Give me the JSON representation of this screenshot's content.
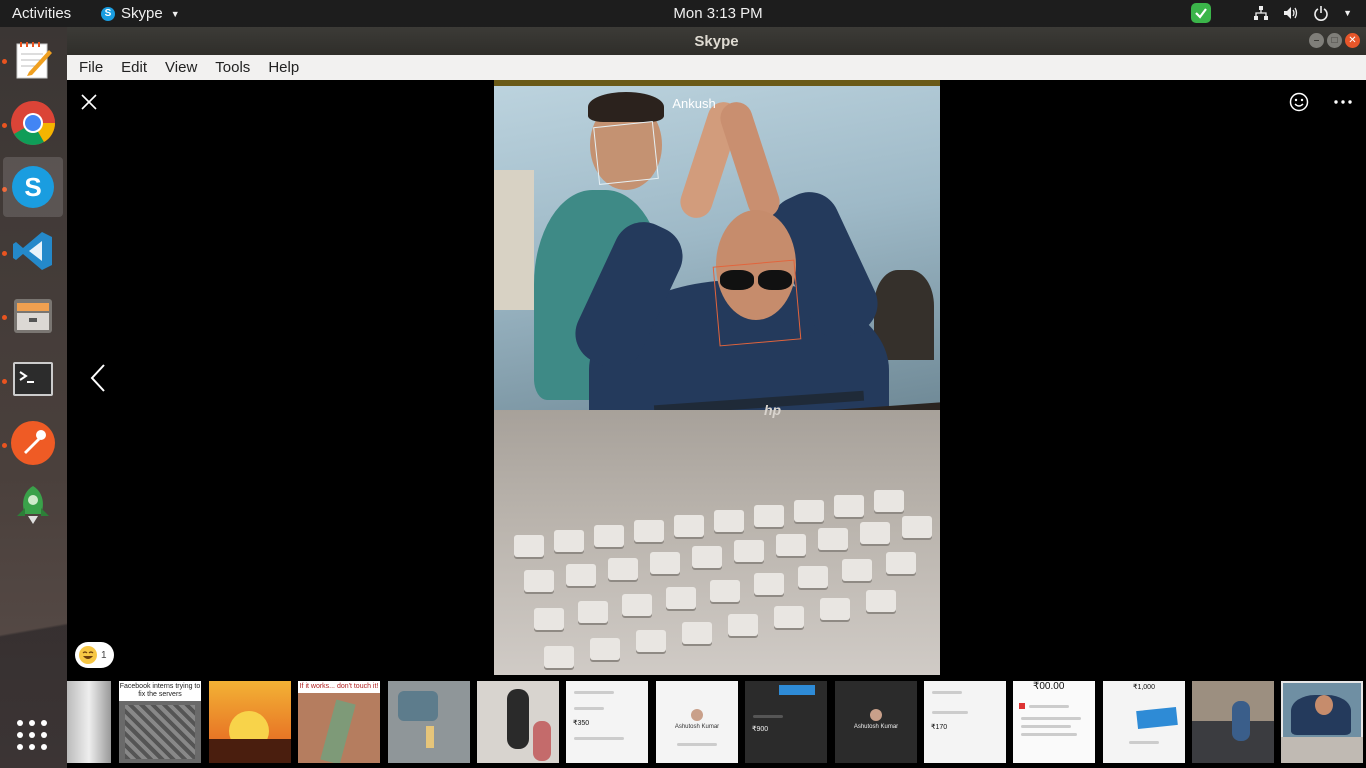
{
  "topbar": {
    "activities": "Activities",
    "app_name": "Skype",
    "clock": "Mon  3:13 PM"
  },
  "window": {
    "title": "Skype"
  },
  "menu": {
    "items": [
      "File",
      "Edit",
      "View",
      "Tools",
      "Help"
    ]
  },
  "dock": {
    "apps": [
      "text-editor",
      "chrome",
      "skype",
      "vscode",
      "file-manager",
      "terminal",
      "postman",
      "other-app"
    ]
  },
  "viewer": {
    "sender_name": "Ankush",
    "reaction_count": "1",
    "laptop_brand": "hp"
  },
  "thumbnails": [
    {
      "kind": "photo"
    },
    {
      "kind": "meme",
      "caption": "Facebook interns trying to fix the servers"
    },
    {
      "kind": "festival"
    },
    {
      "kind": "meme",
      "caption": "If it works... don't touch it!"
    },
    {
      "kind": "photo"
    },
    {
      "kind": "photo"
    },
    {
      "kind": "payment",
      "amount": "₹350"
    },
    {
      "kind": "payment",
      "name": "Ashutosh Kumar"
    },
    {
      "kind": "payment-dark",
      "amount": "₹900"
    },
    {
      "kind": "payment-dark",
      "name": "Ashutosh Kumar"
    },
    {
      "kind": "payment",
      "amount": "₹170"
    },
    {
      "kind": "payment",
      "amount": "₹00.00"
    },
    {
      "kind": "payment",
      "amount": "₹1,000"
    },
    {
      "kind": "photo"
    },
    {
      "kind": "photo",
      "selected": true
    }
  ],
  "colors": {
    "ubuntu_orange": "#e95420",
    "skype_blue": "#1a9de0"
  }
}
